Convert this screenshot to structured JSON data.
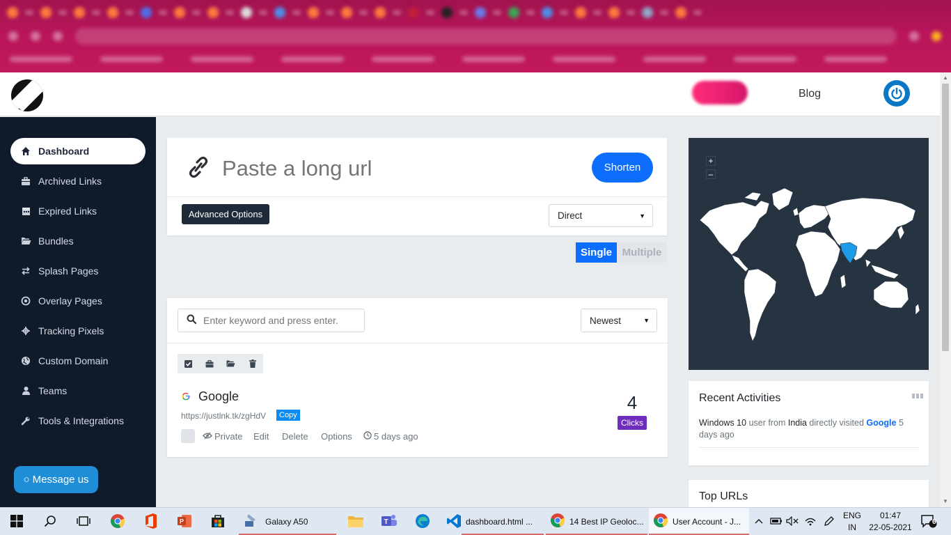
{
  "header": {
    "blog_label": "Blog"
  },
  "sidebar": {
    "items": [
      {
        "label": "Dashboard",
        "icon": "home-icon",
        "active": true
      },
      {
        "label": "Archived Links",
        "icon": "briefcase-icon"
      },
      {
        "label": "Expired Links",
        "icon": "calendar-icon"
      },
      {
        "label": "Bundles",
        "icon": "folder-icon"
      },
      {
        "label": "Splash Pages",
        "icon": "exchange-icon"
      },
      {
        "label": "Overlay Pages",
        "icon": "dot-circle-icon"
      },
      {
        "label": "Tracking Pixels",
        "icon": "crosshair-icon"
      },
      {
        "label": "Custom Domain",
        "icon": "globe-icon"
      },
      {
        "label": "Teams",
        "icon": "user-icon"
      },
      {
        "label": "Tools & Integrations",
        "icon": "wrench-icon"
      }
    ],
    "message_button": "○ Message us"
  },
  "shorten": {
    "placeholder": "Paste a long url",
    "button": "Shorten",
    "advanced_options": "Advanced Options",
    "redirect_type": "Direct",
    "mode_single": "Single",
    "mode_multiple": "Multiple"
  },
  "links": {
    "search_placeholder": "Enter keyword and press enter.",
    "sort": "Newest",
    "items": [
      {
        "title": "Google",
        "short_url": "https://justlnk.tk/zgHdV",
        "copy_label": "Copy",
        "privacy": "Private",
        "edit": "Edit",
        "delete": "Delete",
        "options": "Options",
        "age": "5 days ago",
        "clicks": "4",
        "clicks_label": "Clicks"
      }
    ]
  },
  "map": {
    "zoom_in": "+",
    "zoom_out": "–",
    "highlighted_country": "India",
    "highlight_color": "#1e9be8"
  },
  "activities": {
    "title": "Recent Activities",
    "entry": {
      "os": "Windows 10",
      "t1": " user from ",
      "country": "India",
      "t2": " directly visited ",
      "link": "Google",
      "time": " 5 days ago"
    }
  },
  "top_urls": {
    "title": "Top URLs"
  },
  "taskbar": {
    "apps": [
      {
        "label": "Galaxy A50"
      },
      {
        "label": "dashboard.html ..."
      },
      {
        "label": "14 Best IP Geoloc..."
      },
      {
        "label": "User Account - J..."
      }
    ],
    "lang_1": "ENG",
    "lang_2": "IN",
    "time": "01:47",
    "date": "22-05-2021",
    "notifications": "6"
  },
  "colors": {
    "accent": "#0d6efd",
    "sidebar_bg": "#0f1a2b",
    "clicks_badge": "#6f2dbd",
    "map_bg": "#263341"
  }
}
